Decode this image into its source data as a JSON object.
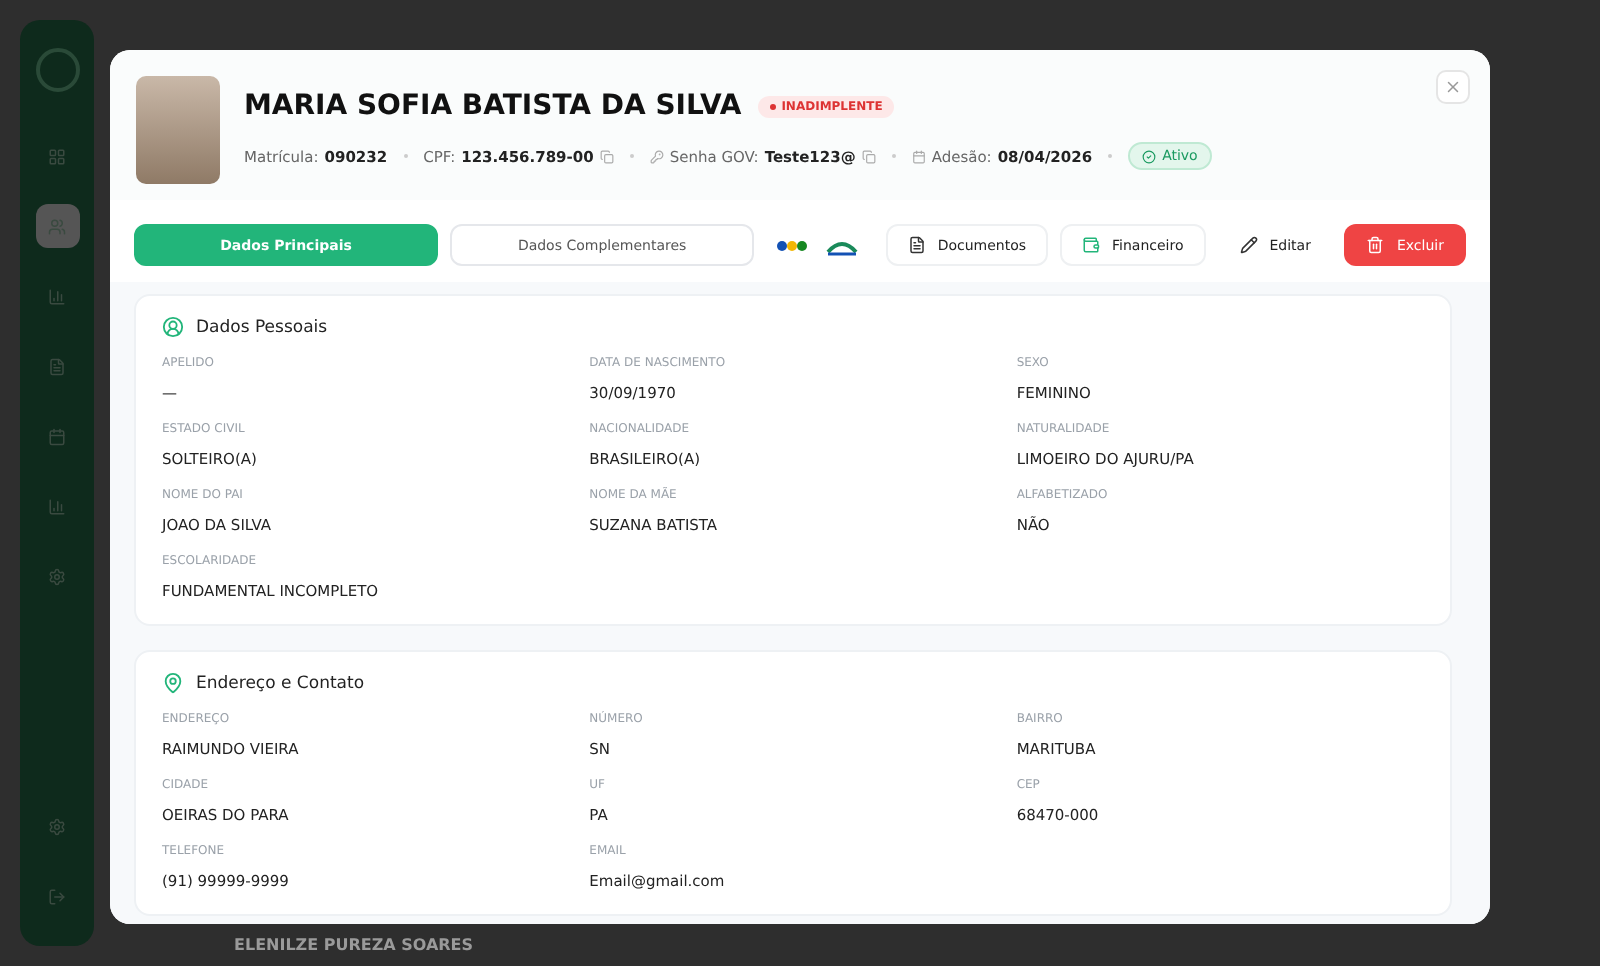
{
  "sidebar": {
    "items": [
      {
        "kind": "grid",
        "selected": false
      },
      {
        "kind": "users",
        "selected": true
      },
      {
        "kind": "chart",
        "selected": false
      },
      {
        "kind": "doc",
        "selected": false
      },
      {
        "kind": "calendar",
        "selected": false
      },
      {
        "kind": "chart",
        "selected": false
      },
      {
        "kind": "gear",
        "selected": false
      }
    ],
    "bottom": [
      {
        "kind": "gear"
      },
      {
        "kind": "logout"
      }
    ]
  },
  "background_row": {
    "name": "ELENILZE PUREZA SOARES"
  },
  "modal": {
    "name": "MARIA SOFIA BATISTA DA SILVA",
    "status_badge": "INADIMPLENTE",
    "meta": [
      {
        "label": "Matrícula:",
        "value": "090232",
        "copyable": false
      },
      {
        "label": "CPF:",
        "value": "123.456.789-00",
        "copyable": true
      },
      {
        "label": "Senha GOV:",
        "value": "Teste123@",
        "copyable": true
      },
      {
        "label": "Adesão:",
        "value": "08/04/2026",
        "copyable": false
      }
    ],
    "active_badge": "Ativo",
    "tabs": [
      {
        "label": "Dados Principais",
        "selected": true
      },
      {
        "label": "Dados Complementares",
        "selected": false
      }
    ],
    "actions": [
      {
        "kind": "document",
        "label": "Documentos"
      },
      {
        "kind": "wallet",
        "label": "Financeiro"
      },
      {
        "kind": "edit",
        "label": "Editar"
      },
      {
        "kind": "trash",
        "label": "Excluir"
      }
    ],
    "sections": [
      {
        "title": "Dados Pessoais",
        "fields": [
          {
            "label": "APELIDO",
            "value": "—"
          },
          {
            "label": "DATA DE NASCIMENTO",
            "value": "30/09/1970"
          },
          {
            "label": "SEXO",
            "value": "FEMININO"
          },
          {
            "label": "ESTADO CIVIL",
            "value": "SOLTEIRO(A)"
          },
          {
            "label": "NACIONALIDADE",
            "value": "BRASILEIRO(A)"
          },
          {
            "label": "NATURALIDADE",
            "value": "LIMOEIRO DO AJURU/PA"
          },
          {
            "label": "NOME DO PAI",
            "value": "JOAO DA SILVA"
          },
          {
            "label": "NOME DA MÃE",
            "value": "SUZANA BATISTA"
          },
          {
            "label": "ALFABETIZADO",
            "value": "NÃO"
          },
          {
            "label": "ESCOLARIDADE",
            "value": "FUNDAMENTAL INCOMPLETO"
          }
        ]
      },
      {
        "title": "Endereço e Contato",
        "fields": [
          {
            "label": "ENDEREÇO",
            "value": "RAIMUNDO VIEIRA"
          },
          {
            "label": "NÚMERO",
            "value": "SN"
          },
          {
            "label": "BAIRRO",
            "value": "MARITUBA"
          },
          {
            "label": "CIDADE",
            "value": "OEIRAS DO PARA"
          },
          {
            "label": "UF",
            "value": "PA"
          },
          {
            "label": "CEP",
            "value": "68470-000"
          },
          {
            "label": "TELEFONE",
            "value": "(91) 99999-9999"
          },
          {
            "label": "EMAIL",
            "value": "Email@gmail.com"
          }
        ]
      }
    ]
  }
}
